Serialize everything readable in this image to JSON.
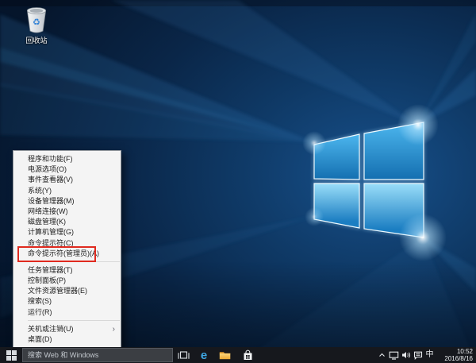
{
  "desktop": {
    "icons": [
      {
        "icon": "recycle-bin-icon",
        "label": "回收站"
      }
    ]
  },
  "menu": {
    "items": [
      {
        "label": "程序和功能(F)"
      },
      {
        "label": "电源选项(O)"
      },
      {
        "label": "事件查看器(V)"
      },
      {
        "label": "系统(Y)"
      },
      {
        "label": "设备管理器(M)"
      },
      {
        "label": "网络连接(W)"
      },
      {
        "label": "磁盘管理(K)"
      },
      {
        "label": "计算机管理(G)"
      },
      {
        "label": "命令提示符(C)"
      },
      {
        "label": "命令提示符(管理员)(A)",
        "highlighted": true
      },
      {
        "label": "任务管理器(T)"
      },
      {
        "label": "控制面板(P)"
      },
      {
        "label": "文件资源管理器(E)"
      },
      {
        "label": "搜索(S)"
      },
      {
        "label": "运行(R)"
      },
      {
        "label": "关机或注销(U)",
        "has_submenu": true
      },
      {
        "label": "桌面(D)"
      }
    ],
    "submenu_arrow": "›",
    "highlight_color": "#e02a1f"
  },
  "taskbar": {
    "start": {
      "icon": "windows-logo-icon"
    },
    "search": {
      "placeholder": "搜索 Web 和 Windows"
    },
    "buttons": [
      {
        "icon": "task-view-icon"
      },
      {
        "icon": "edge-icon",
        "glyph": "e"
      },
      {
        "icon": "file-explorer-icon"
      },
      {
        "icon": "store-icon"
      }
    ],
    "tray": {
      "ime": "中",
      "time": "10:52",
      "date": "2016/8/16"
    }
  },
  "colors": {
    "menu_highlight_red": "#e02a1f",
    "edge_blue": "#3ea8e5",
    "folder_yellow": "#f5b73d",
    "logo_pane_blue": "#2f9bd8",
    "taskbar_bg": "#16181d"
  }
}
